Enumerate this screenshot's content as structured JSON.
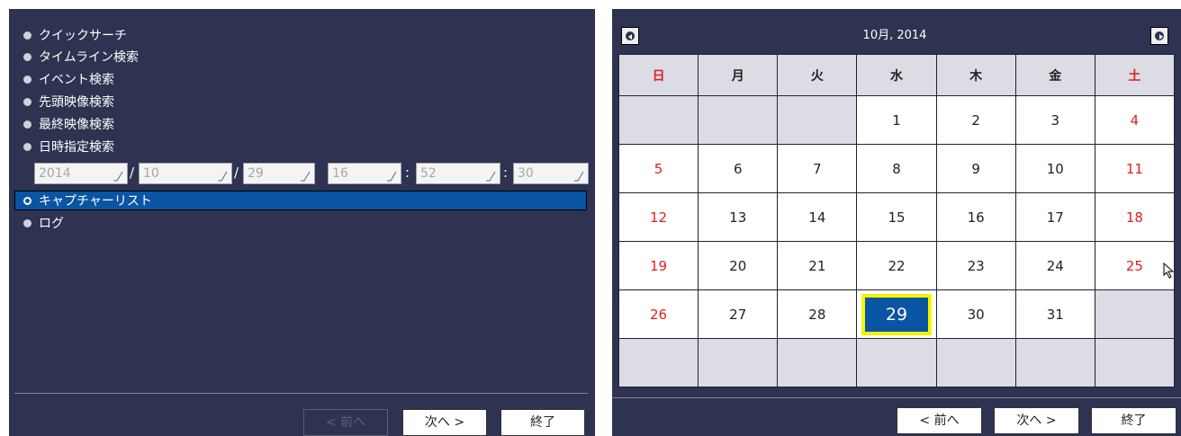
{
  "menu": {
    "items": [
      {
        "label": "クイックサーチ"
      },
      {
        "label": "タイムライン検索"
      },
      {
        "label": "イベント検索"
      },
      {
        "label": "先頭映像検索"
      },
      {
        "label": "最終映像検索"
      },
      {
        "label": "日時指定検索"
      },
      {
        "label": "キャプチャーリスト"
      },
      {
        "label": "ログ"
      }
    ],
    "selected_index": 6
  },
  "datetime": {
    "year": "2014",
    "month": "10",
    "day": "29",
    "hour": "16",
    "minute": "52",
    "second": "30",
    "date_sep": "/",
    "time_sep": ":"
  },
  "left_buttons": {
    "prev": "< 前へ",
    "next": "次へ >",
    "end": "終了"
  },
  "calendar": {
    "title": "10月, 2014",
    "weekdays": [
      "日",
      "月",
      "火",
      "水",
      "木",
      "金",
      "土"
    ],
    "weeks": [
      [
        "",
        "",
        "",
        "1",
        "2",
        "3",
        "4"
      ],
      [
        "5",
        "6",
        "7",
        "8",
        "9",
        "10",
        "11"
      ],
      [
        "12",
        "13",
        "14",
        "15",
        "16",
        "17",
        "18"
      ],
      [
        "19",
        "20",
        "21",
        "22",
        "23",
        "24",
        "25"
      ],
      [
        "26",
        "27",
        "28",
        "29",
        "30",
        "31",
        ""
      ],
      [
        "",
        "",
        "",
        "",
        "",
        "",
        ""
      ]
    ],
    "selected_day": "29",
    "weekend_color": "#e02020",
    "selected_color": "#0a54a4",
    "highlight_color": "#f5f500"
  },
  "right_buttons": {
    "prev": "< 前へ",
    "next": "次へ >",
    "end": "終了"
  }
}
